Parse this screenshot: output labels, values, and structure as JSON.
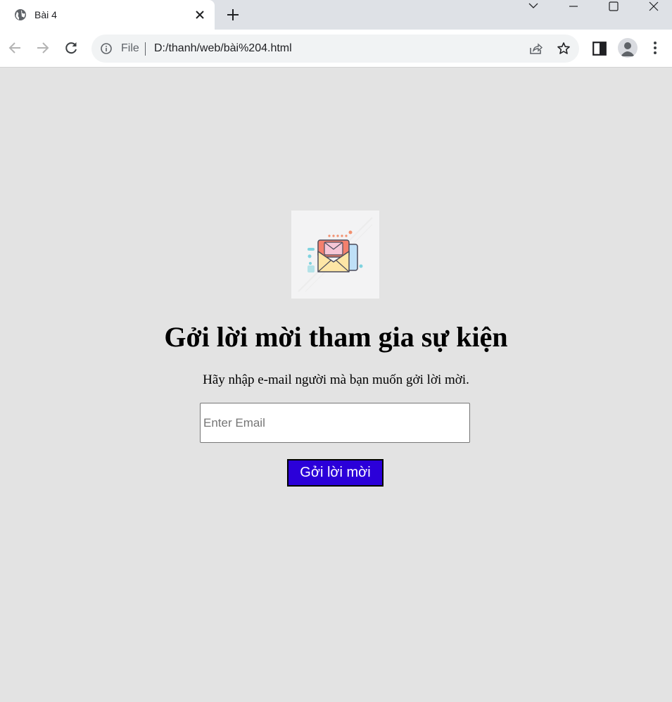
{
  "browser": {
    "tab": {
      "title": "Bài 4"
    },
    "address_bar": {
      "scheme_label": "File",
      "url": "D:/thanh/web/bài%204.html"
    },
    "icons": {
      "favicon": "globe-icon",
      "tab_close": "close-icon",
      "new_tab": "plus-icon",
      "tab_search": "chevron-down-icon",
      "minimize": "minimize-icon",
      "maximize": "maximize-icon",
      "window_close": "window-close-icon",
      "back": "back-arrow-icon",
      "forward": "forward-arrow-icon",
      "reload": "reload-icon",
      "site_info": "info-icon",
      "share": "share-icon",
      "bookmark": "star-icon",
      "side_panel": "side-panel-icon",
      "profile": "profile-avatar-icon",
      "menu": "kebab-menu-icon"
    }
  },
  "page": {
    "illustration": "envelope-mail-illustration",
    "heading": "Gởi lời mời tham gia sự kiện",
    "subtitle": "Hãy nhập e-mail người mà bạn muốn gởi lời mời.",
    "email_input": {
      "placeholder": "Enter Email",
      "value": ""
    },
    "submit_label": "Gởi lời mời",
    "colors": {
      "background": "#e3e3e3",
      "button_background": "#2b00d9",
      "button_text": "#ffffff"
    }
  }
}
